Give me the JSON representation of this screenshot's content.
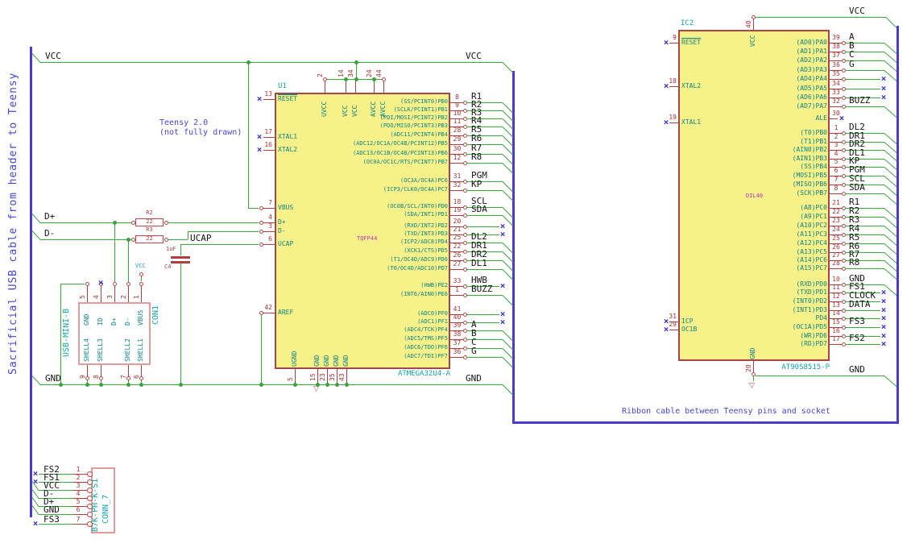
{
  "colors": {
    "wire": "#3fa63f",
    "bus": "#4b39d2",
    "pin": "#b04040",
    "ic_outline": "#a54545",
    "component_outline": "#c24444",
    "connector_outline": "#e09b9b",
    "ic_fill": "#f7f18a",
    "pin_name": "#0f8585",
    "reference": "#14a5a5",
    "footprint": "#b238b2",
    "net_label": "#141414",
    "note": "#4545d8",
    "no_connect": "#3b31d0",
    "field": "#a34646"
  },
  "notes": {
    "left_bus": "Sacrificial USB cable from header to Teensy",
    "teensy_1": "Teensy 2.0",
    "teensy_2": "(not fully drawn)",
    "ribbon": "Ribbon cable between Teensy pins and socket"
  },
  "net_labels": {
    "vcc": "VCC",
    "gnd": "GND",
    "d_plus": "D+",
    "d_minus": "D-",
    "ucap": "UCAP"
  },
  "u1": {
    "ref": "U1",
    "value": "ATMEGA32U4-A",
    "footprint": "TQFP44",
    "top_pins": [
      {
        "num": "2",
        "name": "UVCC"
      },
      {
        "num": "14",
        "name": "VCC"
      },
      {
        "num": "34",
        "name": "VCC"
      },
      {
        "num": "24",
        "name": "AVCC"
      },
      {
        "num": "44",
        "name": "AVCC"
      }
    ],
    "bottom_pins": [
      {
        "num": "5",
        "name": "UGND"
      },
      {
        "num": "15",
        "name": "GND"
      },
      {
        "num": "23",
        "name": "GND"
      },
      {
        "num": "35",
        "name": "GND"
      },
      {
        "num": "43",
        "name": "GND"
      }
    ],
    "left_pins": [
      {
        "num": "13",
        "name": "RESET",
        "nc": true
      },
      {
        "num": "17",
        "name": "XTAL1",
        "nc": true
      },
      {
        "num": "16",
        "name": "XTAL2",
        "nc": true
      },
      {
        "num": "7",
        "name": "VBUS"
      },
      {
        "num": "4",
        "name": "D+"
      },
      {
        "num": "3",
        "name": "D-"
      },
      {
        "num": "6",
        "name": "UCAP"
      },
      {
        "num": "42",
        "name": "AREF"
      }
    ],
    "right_pins": [
      {
        "num": "8",
        "name": "(SS/PCINT0)PB0",
        "net": "R1"
      },
      {
        "num": "9",
        "name": "(SCLK/PCINT1)PB1",
        "net": "R2"
      },
      {
        "num": "10",
        "name": "(PDI/MOSI/PCINT2)PB2",
        "net": "R3"
      },
      {
        "num": "11",
        "name": "(PDO/MISO/PCINT3)PB3",
        "net": "R4"
      },
      {
        "num": "28",
        "name": "(ADC11/PCINT4)PB4",
        "net": "R5"
      },
      {
        "num": "29",
        "name": "(ADC12/OC1A/OC4B/PCINT12)PB5",
        "net": "R6"
      },
      {
        "num": "30",
        "name": "(ADC13/OC1B/OC4B/PCINT13)PB6",
        "net": "R7"
      },
      {
        "num": "12",
        "name": "(OC0A/OC1C/RTS/PCINT7)PB7",
        "net": "R8"
      },
      {
        "num": "31",
        "name": "(OC3A/OC4A)PC6",
        "net": "PGM"
      },
      {
        "num": "32",
        "name": "(ICP3/CLK0/OC4A)PC7",
        "net": "KP"
      },
      {
        "num": "18",
        "name": "(OC0B/SCL/INT0)PD0",
        "net": "SCL"
      },
      {
        "num": "19",
        "name": "(SDA/INT1)PD1",
        "net": "SDA"
      },
      {
        "num": "20",
        "name": "(RXD/INT2)PD2",
        "nc": true
      },
      {
        "num": "21",
        "name": "(TXD/INT3)PD3",
        "nc": true
      },
      {
        "num": "25",
        "name": "(ICP2/ADC8)PD4",
        "net": "DL2"
      },
      {
        "num": "22",
        "name": "(XCK1/CTS)PD5",
        "net": "DR1"
      },
      {
        "num": "26",
        "name": "(T1/OC4D/ADC9)PD6",
        "net": "DR2"
      },
      {
        "num": "27",
        "name": "(T0/OC4D/ADC10)PD7",
        "net": "DL1"
      },
      {
        "num": "33",
        "name": "(HWB)PE2",
        "net": "HWB",
        "nc": true
      },
      {
        "num": "1",
        "name": "(INT6/AIN0)PE6",
        "net": "BUZZ"
      },
      {
        "num": "41",
        "name": "(ADC0)PF0",
        "nc": true
      },
      {
        "num": "40",
        "name": "(ADC1)PF1",
        "nc": true
      },
      {
        "num": "39",
        "name": "(ADC4/TCK)PF4",
        "net": "A"
      },
      {
        "num": "38",
        "name": "(ADC5/TMS)PF5",
        "net": "B"
      },
      {
        "num": "37",
        "name": "(ADC6/TDO)PF6",
        "net": "C"
      },
      {
        "num": "36",
        "name": "(ADC7/TDI)PF7",
        "net": "G"
      }
    ]
  },
  "ic2": {
    "ref": "IC2",
    "value": "AT90S8515-P",
    "footprint": "DIL40",
    "top_pins": [
      {
        "num": "40",
        "name": "VCC"
      }
    ],
    "bottom_pins": [
      {
        "num": "20",
        "name": "GND"
      }
    ],
    "left_pins": [
      {
        "num": "9",
        "name": "RESET",
        "nc": true
      },
      {
        "num": "18",
        "name": "XTAL2",
        "nc": true
      },
      {
        "num": "19",
        "name": "XTAL1",
        "nc": true
      },
      {
        "num": "31",
        "name": "ICP",
        "nc": true
      },
      {
        "num": "29",
        "name": "OC1B",
        "nc": true
      }
    ],
    "right_pins": [
      {
        "num": "39",
        "name": "(AD0)PA0",
        "net": "A"
      },
      {
        "num": "38",
        "name": "(AD1)PA1",
        "net": "B"
      },
      {
        "num": "37",
        "name": "(AD2)PA2",
        "net": "C"
      },
      {
        "num": "36",
        "name": "(AD3)PA3",
        "net": "G"
      },
      {
        "num": "35",
        "name": "(AD4)PA4",
        "nc": true
      },
      {
        "num": "34",
        "name": "(AD5)PA5",
        "nc": true
      },
      {
        "num": "33",
        "name": "(AD6)PA6",
        "nc": true
      },
      {
        "num": "32",
        "name": "(AD7)PA7",
        "net": "BUZZ"
      },
      {
        "num": "30",
        "name": "ALE",
        "nc": true,
        "at_pin": true
      },
      {
        "num": "1",
        "name": "(T0)PB0",
        "net": "DL2"
      },
      {
        "num": "2",
        "name": "(T1)PB1",
        "net": "DR1"
      },
      {
        "num": "3",
        "name": "(AIN0)PB2",
        "net": "DR2"
      },
      {
        "num": "4",
        "name": "(AIN1)PB3",
        "net": "DL1"
      },
      {
        "num": "5",
        "name": "(SS)PB4",
        "net": "KP"
      },
      {
        "num": "6",
        "name": "(MOSI)PB5",
        "net": "PGM"
      },
      {
        "num": "7",
        "name": "(MISO)PB6",
        "net": "SCL"
      },
      {
        "num": "8",
        "name": "(SCK)PB7",
        "net": "SDA"
      },
      {
        "num": "21",
        "name": "(A8)PC0",
        "net": "R1"
      },
      {
        "num": "22",
        "name": "(A9)PC1",
        "net": "R2"
      },
      {
        "num": "23",
        "name": "(A10)PC2",
        "net": "R3"
      },
      {
        "num": "24",
        "name": "(A11)PC3",
        "net": "R4"
      },
      {
        "num": "25",
        "name": "(A12)PC4",
        "net": "R5"
      },
      {
        "num": "26",
        "name": "(A13)PC5",
        "net": "R6"
      },
      {
        "num": "27",
        "name": "(A14)PC6",
        "net": "R7"
      },
      {
        "num": "28",
        "name": "(A15)PC7",
        "net": "R8"
      },
      {
        "num": "10",
        "name": "(RXD)PD0",
        "net": "GND"
      },
      {
        "num": "11",
        "name": "(TXD)PD1",
        "net": "FS1",
        "nc": true
      },
      {
        "num": "12",
        "name": "(INT0)PD2",
        "net": "CLOCK",
        "nc": true
      },
      {
        "num": "13",
        "name": "(INT1)PD3",
        "net": "DATA",
        "nc": true
      },
      {
        "num": "14",
        "name": "PD4",
        "nc": true
      },
      {
        "num": "15",
        "name": "(OC1A)PD5",
        "net": "FS3",
        "nc": true
      },
      {
        "num": "16",
        "name": "(WR)PD6",
        "nc": true
      },
      {
        "num": "17",
        "name": "(RD)PD7",
        "net": "FS2",
        "nc": true
      }
    ]
  },
  "con1": {
    "ref": "CON1",
    "value": "USB-MINI-B",
    "top_pins": [
      {
        "num": "5",
        "name": "GND"
      },
      {
        "num": "4",
        "name": "ID",
        "nc": true
      },
      {
        "num": "3",
        "name": "D+"
      },
      {
        "num": "2",
        "name": "D-"
      },
      {
        "num": "1",
        "name": "VBUS"
      }
    ],
    "bottom_pins": [
      {
        "num": "9",
        "name": "SHELL4"
      },
      {
        "num": "8",
        "name": "SHELL3"
      },
      {
        "num": "7",
        "name": "SHELL2"
      },
      {
        "num": "6",
        "name": "SHELL1"
      }
    ]
  },
  "conn7": {
    "ref": "CONN_7",
    "value": "B7K-PH-K-S1",
    "pins": [
      {
        "num": "1",
        "net": "FS2",
        "nc": true
      },
      {
        "num": "2",
        "net": "FS1",
        "nc": true
      },
      {
        "num": "3",
        "net": "VCC"
      },
      {
        "num": "4",
        "net": "D-"
      },
      {
        "num": "5",
        "net": "D+"
      },
      {
        "num": "6",
        "net": "GND"
      },
      {
        "num": "7",
        "net": "FS3",
        "nc": true
      }
    ]
  },
  "r2": {
    "ref": "R2",
    "value": "22"
  },
  "r3": {
    "ref": "R3",
    "value": "22"
  },
  "c4": {
    "ref": "C4",
    "value": "1uF"
  }
}
